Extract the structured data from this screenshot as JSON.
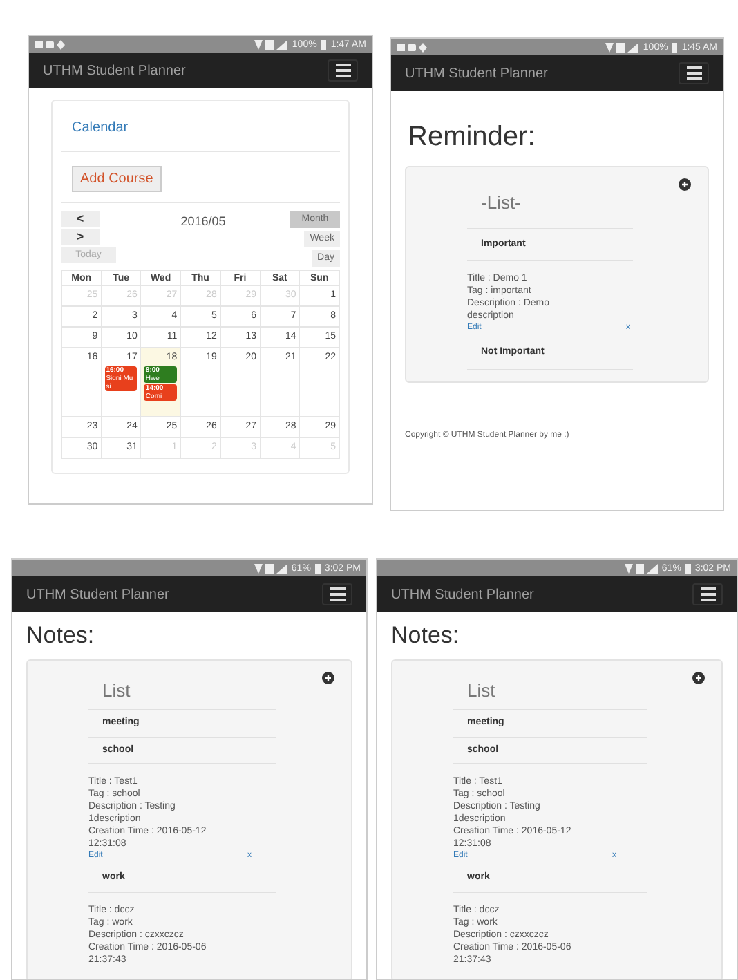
{
  "screens": [
    {
      "kind": "calendar",
      "status_bar": {
        "battery": "100%",
        "time": "1:47 AM",
        "notification_icons": true
      },
      "app_title": "UTHM Student Planner",
      "nav_link": "Calendar",
      "add_button": "Add Course",
      "prev_button": "<",
      "next_button": ">",
      "today_button": "Today",
      "period_title": "2016/05",
      "views": [
        {
          "label": "Month",
          "selected": true
        },
        {
          "label": "Week",
          "selected": false
        },
        {
          "label": "Day",
          "selected": false
        }
      ],
      "weekdays": [
        "Mon",
        "Tue",
        "Wed",
        "Thu",
        "Fri",
        "Sat",
        "Sun"
      ],
      "weeks": [
        [
          {
            "label": "25",
            "other_month": true
          },
          {
            "label": "26",
            "other_month": true
          },
          {
            "label": "27",
            "other_month": true
          },
          {
            "label": "28",
            "other_month": true
          },
          {
            "label": "29",
            "other_month": true
          },
          {
            "label": "30",
            "other_month": true
          },
          {
            "label": "1",
            "other_month": false
          }
        ],
        [
          {
            "label": "2",
            "other_month": false
          },
          {
            "label": "3",
            "other_month": false
          },
          {
            "label": "4",
            "other_month": false
          },
          {
            "label": "5",
            "other_month": false
          },
          {
            "label": "6",
            "other_month": false
          },
          {
            "label": "7",
            "other_month": false
          },
          {
            "label": "8",
            "other_month": false
          }
        ],
        [
          {
            "label": "9",
            "other_month": false
          },
          {
            "label": "10",
            "other_month": false
          },
          {
            "label": "11",
            "other_month": false
          },
          {
            "label": "12",
            "other_month": false
          },
          {
            "label": "13",
            "other_month": false
          },
          {
            "label": "14",
            "other_month": false
          },
          {
            "label": "15",
            "other_month": false
          }
        ],
        [
          {
            "label": "16",
            "other_month": false
          },
          {
            "label": "17",
            "other_month": false,
            "events": [
              {
                "time": "16:00",
                "title": "Signi Musi",
                "color": "#e8401c"
              }
            ]
          },
          {
            "label": "18",
            "other_month": false,
            "today": true,
            "events": [
              {
                "time": "8:00",
                "title": "Hwe",
                "color": "#2e7d1f"
              },
              {
                "time": "14:00",
                "title": "Comi",
                "color": "#e8401c"
              }
            ]
          },
          {
            "label": "19",
            "other_month": false
          },
          {
            "label": "20",
            "other_month": false
          },
          {
            "label": "21",
            "other_month": false
          },
          {
            "label": "22",
            "other_month": false
          }
        ],
        [
          {
            "label": "23",
            "other_month": false
          },
          {
            "label": "24",
            "other_month": false
          },
          {
            "label": "25",
            "other_month": false
          },
          {
            "label": "26",
            "other_month": false
          },
          {
            "label": "27",
            "other_month": false
          },
          {
            "label": "28",
            "other_month": false
          },
          {
            "label": "29",
            "other_month": false
          }
        ],
        [
          {
            "label": "30",
            "other_month": false
          },
          {
            "label": "31",
            "other_month": false
          },
          {
            "label": "1",
            "other_month": true
          },
          {
            "label": "2",
            "other_month": true
          },
          {
            "label": "3",
            "other_month": true
          },
          {
            "label": "4",
            "other_month": true
          },
          {
            "label": "5",
            "other_month": true
          }
        ]
      ]
    },
    {
      "kind": "list",
      "status_bar": {
        "battery": "100%",
        "time": "1:45 AM",
        "notification_icons": true
      },
      "app_title": "UTHM Student Planner",
      "heading": "Reminder:",
      "list_title": "-List-",
      "groups": [
        {
          "label": "Important",
          "entries": [
            {
              "lines": [
                "Title : Demo 1",
                "Tag : important",
                "Description : Demo description"
              ],
              "edit": "Edit",
              "delete": "x"
            }
          ]
        },
        {
          "label": "Not Important"
        }
      ],
      "footer": "Copyright © UTHM Student Planner by me :)"
    },
    {
      "kind": "list",
      "status_bar": {
        "battery": "61%",
        "time": "3:02 PM",
        "notification_icons": false
      },
      "app_title": "UTHM Student Planner",
      "heading": "Notes:",
      "list_title": "List",
      "groups": [
        {
          "label": "meeting"
        },
        {
          "label": "school",
          "entries": [
            {
              "lines": [
                "Title : Test1",
                "Tag : school",
                "Description : Testing 1description",
                "Creation Time : 2016-05-12 12:31:08"
              ],
              "edit": "Edit",
              "delete": "x"
            }
          ]
        },
        {
          "label": "work",
          "entries": [
            {
              "lines": [
                "Title : dccz",
                "Tag : work",
                "Description : czxxczcz",
                "Creation Time : 2016-05-06 21:37:43"
              ]
            }
          ]
        }
      ]
    },
    {
      "kind": "list",
      "status_bar": {
        "battery": "61%",
        "time": "3:02 PM",
        "notification_icons": false
      },
      "app_title": "UTHM Student Planner",
      "heading": "Notes:",
      "list_title": "List",
      "groups": [
        {
          "label": "meeting"
        },
        {
          "label": "school",
          "entries": [
            {
              "lines": [
                "Title : Test1",
                "Tag : school",
                "Description : Testing 1description",
                "Creation Time : 2016-05-12 12:31:08"
              ],
              "edit": "Edit",
              "delete": "x"
            }
          ]
        },
        {
          "label": "work",
          "entries": [
            {
              "lines": [
                "Title : dccz",
                "Tag : work",
                "Description : czxxczcz",
                "Creation Time : 2016-05-06 21:37:43"
              ]
            }
          ]
        }
      ]
    }
  ]
}
